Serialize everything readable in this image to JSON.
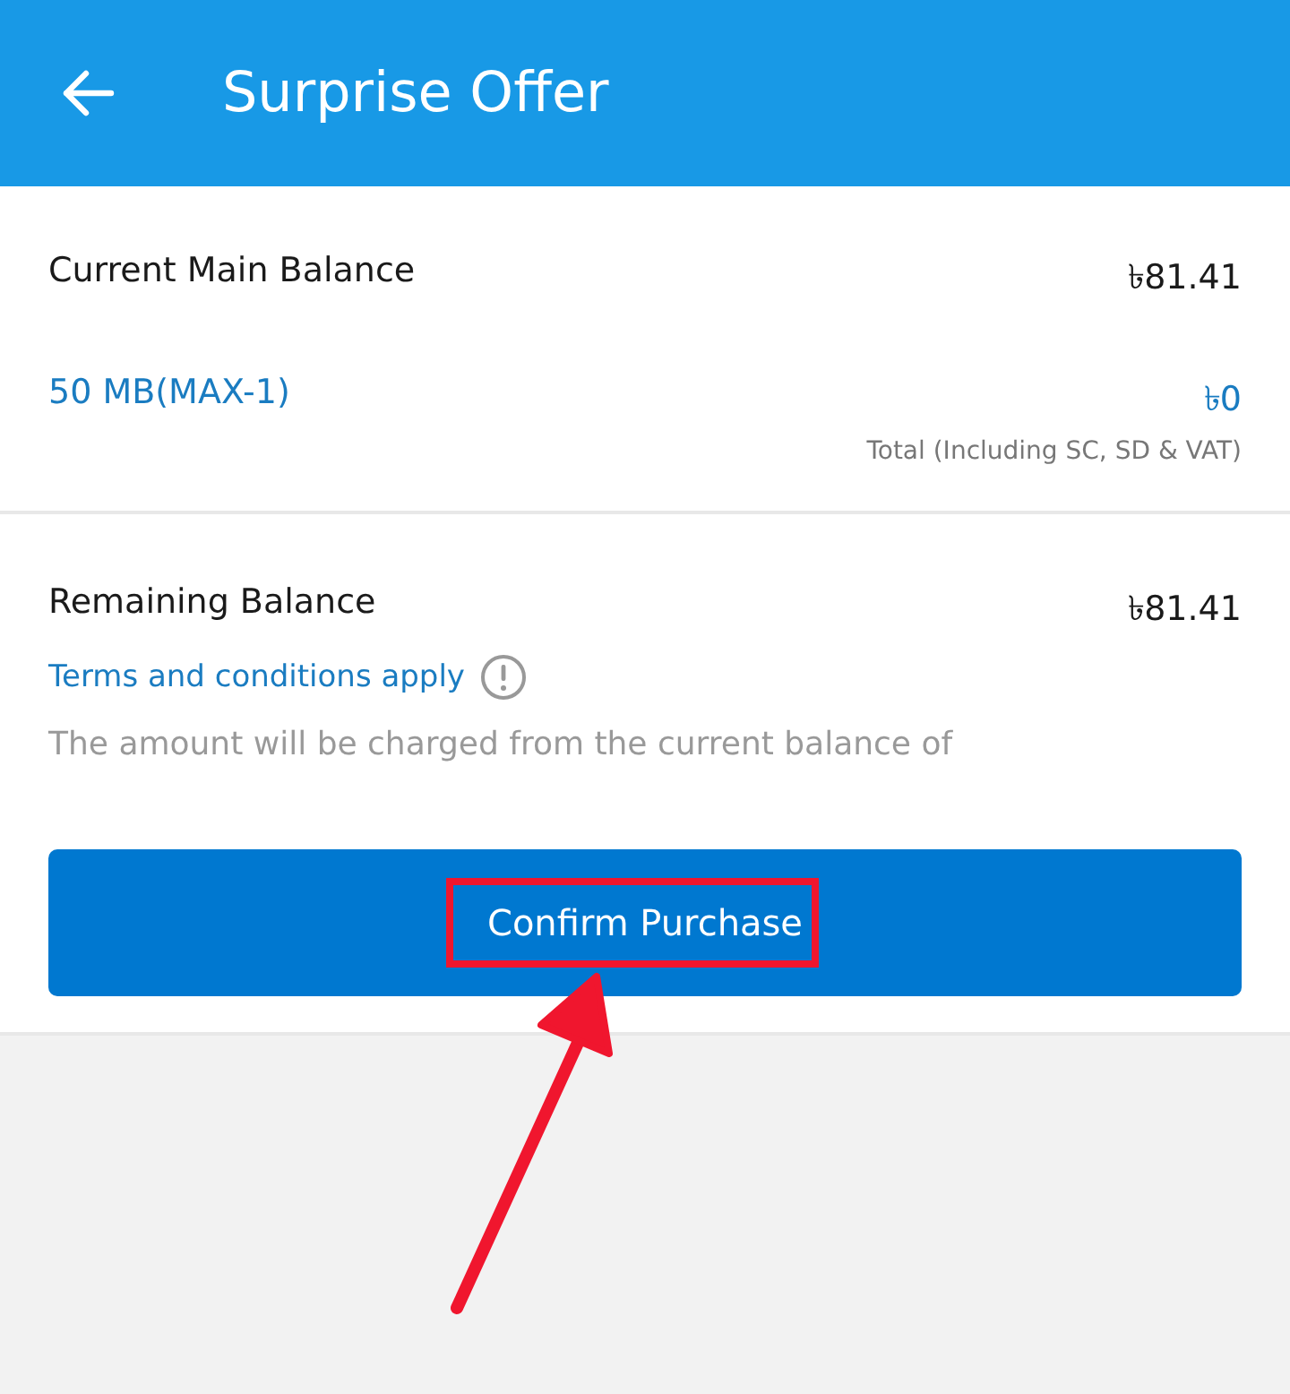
{
  "header": {
    "title": "Surprise Offer"
  },
  "summary": {
    "balance_label": "Current Main Balance",
    "balance_value": "৳81.41",
    "pack_name": "50 MB(MAX-1)",
    "pack_price": "৳0",
    "price_note": "Total (Including SC, SD & VAT)"
  },
  "remaining": {
    "label": "Remaining Balance",
    "value": "৳81.41",
    "terms_link": "Terms and conditions apply",
    "note": "The amount will be charged from the current balance of"
  },
  "confirm_button": {
    "label": "Confirm Purchase",
    "highlighted": true
  }
}
